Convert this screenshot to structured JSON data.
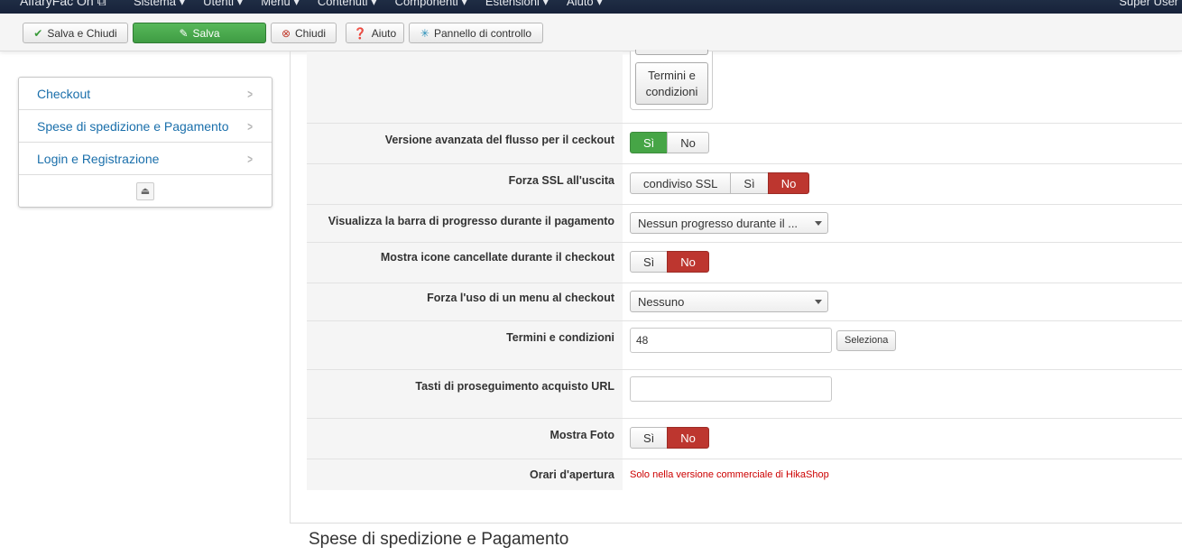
{
  "topnav": {
    "brand": "AlfaryFac On ⧉",
    "menu": [
      "Sistema ▾",
      "Utenti ▾",
      "Menu ▾",
      "Contenuti ▾",
      "Componenti ▾",
      "Estensioni ▾",
      "Aiuto ▾"
    ],
    "user": "Super User"
  },
  "toolbar": {
    "save_close": "Salva e Chiudi",
    "save": "Salva",
    "close": "Chiudi",
    "help": "Aiuto",
    "control_panel": "Pannello di controllo"
  },
  "sidebar": {
    "items": [
      {
        "label": "Checkout"
      },
      {
        "label": "Spese di spedizione e Pagamento"
      },
      {
        "label": "Login e Registrazione"
      }
    ]
  },
  "terms_button": "Termini e condizioni",
  "form": {
    "advanced_flow": {
      "label": "Versione avanzata del flusso per il ceckout",
      "options": [
        "Sì",
        "No"
      ],
      "selected": "Sì"
    },
    "force_ssl": {
      "label": "Forza SSL all'uscita",
      "options": [
        "condiviso SSL",
        "Sì",
        "No"
      ],
      "selected": "No"
    },
    "progress_bar": {
      "label": "Visualizza la barra di progresso durante il pagamento",
      "value": "Nessun progresso durante il ..."
    },
    "cancel_icons": {
      "label": "Mostra icone cancellate durante il checkout",
      "options": [
        "Sì",
        "No"
      ],
      "selected": "No"
    },
    "force_menu": {
      "label": "Forza l'uso di un menu al checkout",
      "value": "Nessuno"
    },
    "terms": {
      "label": "Termini e condizioni",
      "value": "48",
      "button": "Seleziona"
    },
    "continue_url": {
      "label": "Tasti di proseguimento acquisto URL",
      "value": ""
    },
    "show_photo": {
      "label": "Mostra Foto",
      "options": [
        "Sì",
        "No"
      ],
      "selected": "No"
    },
    "opening_hours": {
      "label": "Orari d'apertura",
      "note": "Solo nella versione commerciale di HikaShop"
    }
  },
  "section_legend": "Spese di spedizione e Pagamento",
  "colors": {
    "green": "#46a546",
    "red": "#bd362f",
    "link": "#1a6fab"
  }
}
